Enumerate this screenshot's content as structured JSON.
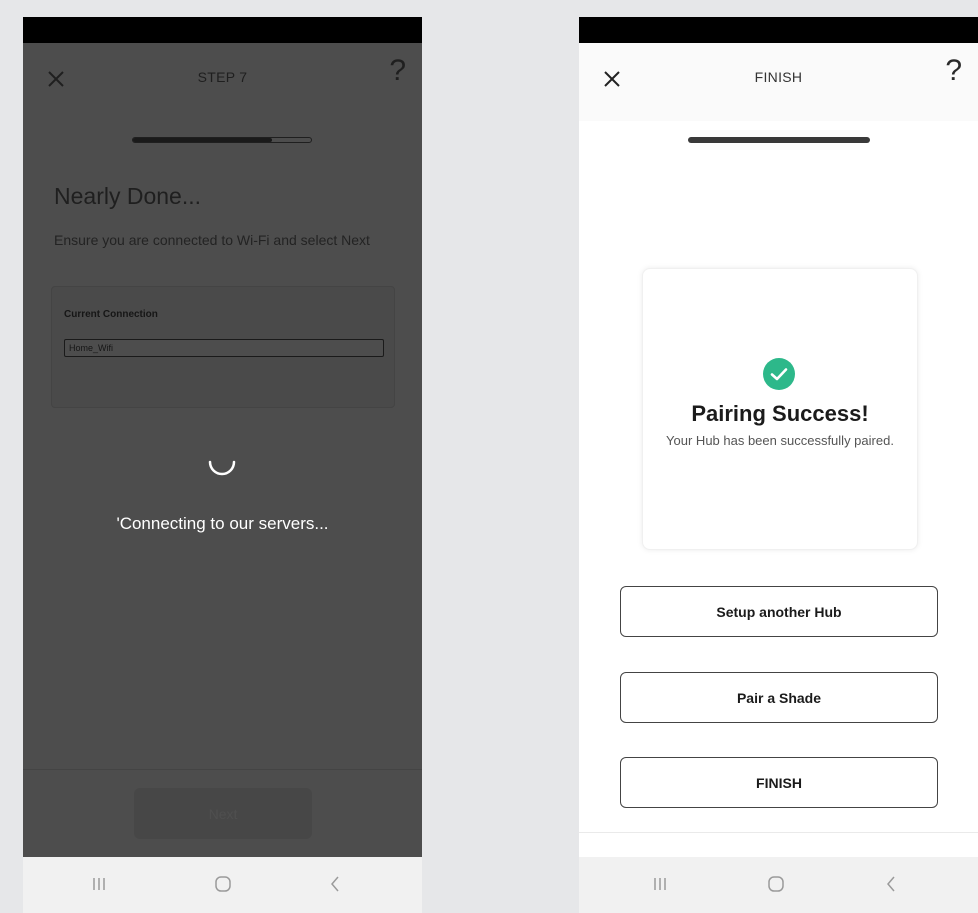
{
  "left_screen": {
    "header": {
      "title": "STEP 7",
      "close_icon": "close-icon",
      "help_label": "?"
    },
    "progress": {
      "fraction": 0.78
    },
    "title": "Nearly Done...",
    "description": "Ensure you are connected to Wi-Fi and select Next",
    "connection_card": {
      "label": "Current Connection",
      "value": "Home_Wifi"
    },
    "loading_text": "'Connecting to our servers...",
    "next_label": "Next",
    "colors": {
      "overlay": "#4d4d4d",
      "text": "#ffffff"
    }
  },
  "right_screen": {
    "header": {
      "title": "FINISH",
      "close_icon": "close-icon",
      "help_label": "?"
    },
    "progress": {
      "fraction": 1.0
    },
    "success": {
      "icon": "check-circle-icon",
      "title": "Pairing Success!",
      "description": "Your Hub has been successfully paired."
    },
    "buttons": {
      "setup_another": "Setup another Hub",
      "pair_shade": "Pair a Shade",
      "finish": "FINISH"
    },
    "colors": {
      "success": "#2db88a"
    }
  },
  "navbar": {
    "icons": [
      "recent-apps-icon",
      "home-icon",
      "back-icon"
    ]
  }
}
